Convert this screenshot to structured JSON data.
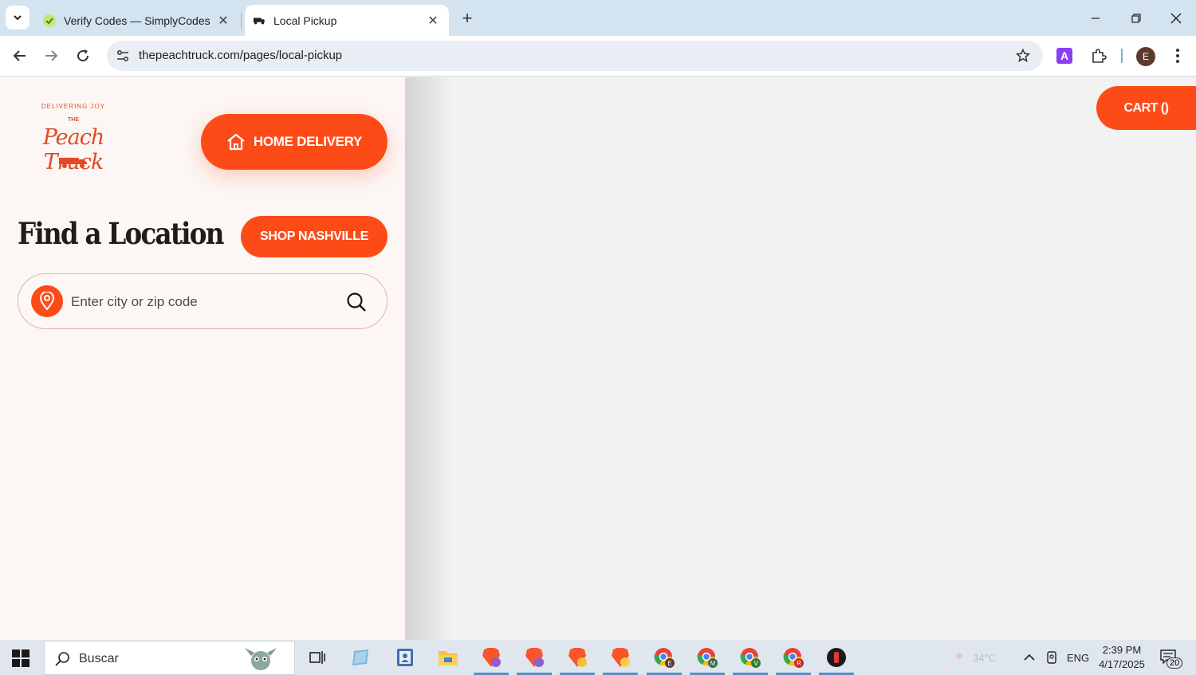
{
  "browser": {
    "tabs": [
      {
        "title": "Verify Codes — SimplyCodes",
        "active": false,
        "favicon": "simplycodes-icon"
      },
      {
        "title": "Local Pickup",
        "active": true,
        "favicon": "peach-truck-icon"
      }
    ],
    "url": "thepeachtruck.com/pages/local-pickup",
    "profile_initial": "E",
    "extension_label": "A"
  },
  "page": {
    "logo": {
      "arc_text": "DELIVERING JOY",
      "the": "THE",
      "script": "Peach Truck",
      "est_left": "EST",
      "est_right": "2012"
    },
    "home_delivery_label": "HOME DELIVERY",
    "heading": "Find a Location",
    "shop_nashville_label": "SHOP NASHVILLE",
    "search": {
      "placeholder": "Enter city or zip code",
      "value": ""
    },
    "cart_label": "CART ()"
  },
  "taskbar": {
    "search_label": "Buscar",
    "weather": "34°C",
    "language": "ENG",
    "time": "2:39 PM",
    "date": "4/17/2025",
    "notification_count": "20"
  },
  "colors": {
    "accent": "#fd4b18",
    "sidebar_bg": "#fcf6f4",
    "heading": "#1d1d1b"
  }
}
